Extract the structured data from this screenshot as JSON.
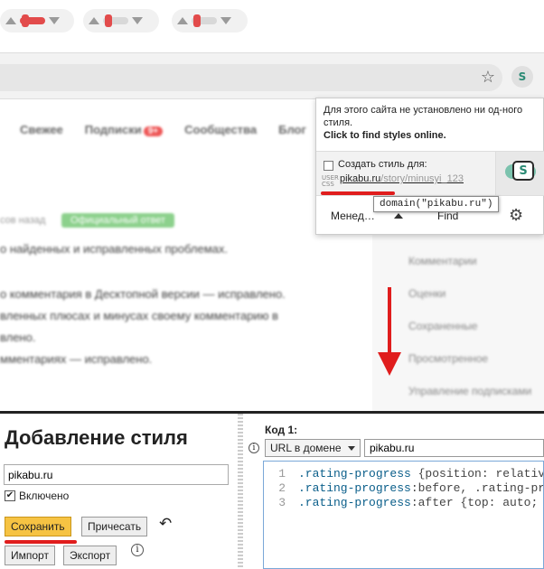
{
  "ratings": [
    {
      "up": "▲",
      "down": "▼"
    },
    {
      "up": "▲",
      "down": "▼"
    },
    {
      "up": "▲",
      "down": "▼"
    }
  ],
  "browser": {
    "star_icon": "☆",
    "extension_icon": "S"
  },
  "page": {
    "nav": [
      {
        "label": "Свежее"
      },
      {
        "label": "Подписки",
        "badge": "9+"
      },
      {
        "label": "Сообщества"
      },
      {
        "label": "Блог"
      }
    ],
    "meta": "сов назад",
    "tag": "Официальный ответ",
    "lines": [
      "о найденных и исправленных проблемах.",
      "о комментария в Десктопной версии — исправлено.",
      "вленных плюсах и минусах своему комментарию в",
      "влено.",
      "мментариях — исправлено."
    ],
    "sidebar": [
      "Комментарии",
      "Оценки",
      "Сохраненные",
      "Просмотренное",
      "Управление подписками"
    ]
  },
  "popup": {
    "no_style_text": "Для этого сайта не установлено ни од-ного стиля.",
    "find_online": "Click to find styles online.",
    "create_label": "Создать стиль для:",
    "usercss_label": "USER CSS",
    "domain_link": "pikabu.ru",
    "domain_path": "/story/minusyi_123",
    "toggle_letter": "S",
    "manage_label": "Менед…",
    "find_label": "Find",
    "tooltip": "domain(\"pikabu.ru\")",
    "gear_icon": "⚙"
  },
  "editor": {
    "title": "Добавление стиля",
    "name_value": "pikabu.ru",
    "enabled_label": "Включено",
    "enabled_checked": "✔",
    "save_label": "Сохранить",
    "beautify_label": "Причесать",
    "undo_icon": "↶",
    "import_label": "Импорт",
    "export_label": "Экспорт",
    "info_icon": "i",
    "code_label": "Код 1:",
    "applies_select": "URL в домене",
    "applies_value": "pikabu.ru",
    "code_lines": [
      {
        "num": "1",
        "sel": ".rating-progress",
        "rest": " {position: relativ"
      },
      {
        "num": "2",
        "sel": ".rating-progress",
        "rest": ":before, .rating-pr"
      },
      {
        "num": "3",
        "sel": ".rating-progress",
        "rest": ":after {top: auto;"
      }
    ]
  },
  "colors": {
    "accent_red": "#e01d1d",
    "save_yellow": "#f6c343",
    "toggle_green": "#7bc2ad"
  }
}
